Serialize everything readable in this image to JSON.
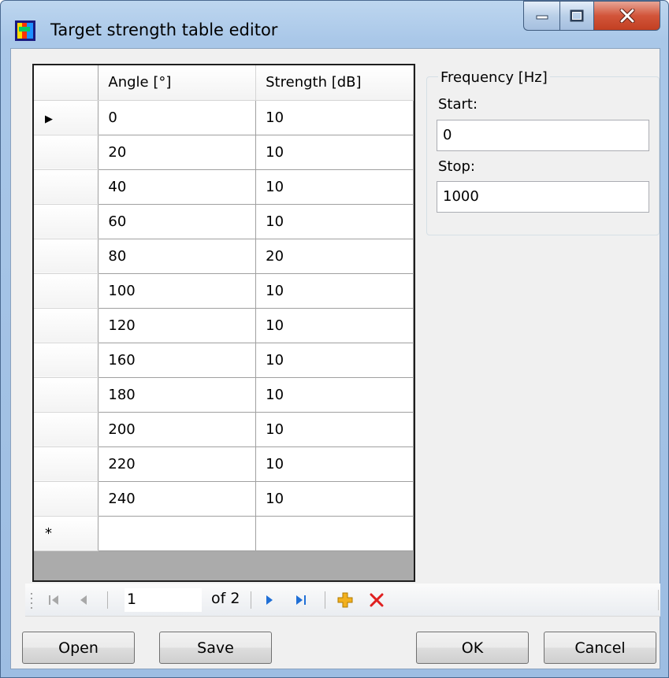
{
  "window": {
    "title": "Target strength table editor",
    "controls": {
      "minimize": "minimize-icon",
      "maximize": "maximize-icon",
      "close": "close-icon"
    }
  },
  "grid": {
    "columns": [
      "Angle [°]",
      "Strength [dB]"
    ],
    "rows": [
      [
        "0",
        "10"
      ],
      [
        "20",
        "10"
      ],
      [
        "40",
        "10"
      ],
      [
        "60",
        "10"
      ],
      [
        "80",
        "20"
      ],
      [
        "100",
        "10"
      ],
      [
        "120",
        "10"
      ],
      [
        "160",
        "10"
      ],
      [
        "180",
        "10"
      ],
      [
        "200",
        "10"
      ],
      [
        "220",
        "10"
      ],
      [
        "240",
        "10"
      ]
    ],
    "current_row_marker": "▶",
    "new_row_marker": "*"
  },
  "frequency": {
    "legend": "Frequency [Hz]",
    "start_label": "Start:",
    "start_value": "0",
    "stop_label": "Stop:",
    "stop_value": "1000"
  },
  "navigator": {
    "position": "1",
    "count_text": "of 2",
    "icons": [
      "move-first-icon",
      "move-previous-icon",
      "move-next-icon",
      "move-last-icon",
      "add-new-icon",
      "delete-icon"
    ]
  },
  "buttons": {
    "open": "Open",
    "save": "Save",
    "ok": "OK",
    "cancel": "Cancel"
  },
  "colors": {
    "accent_blue": "#1f6fd6",
    "delete_red": "#e02020",
    "add_yellow": "#f2b01e",
    "selection_bg": "#ffffff"
  }
}
